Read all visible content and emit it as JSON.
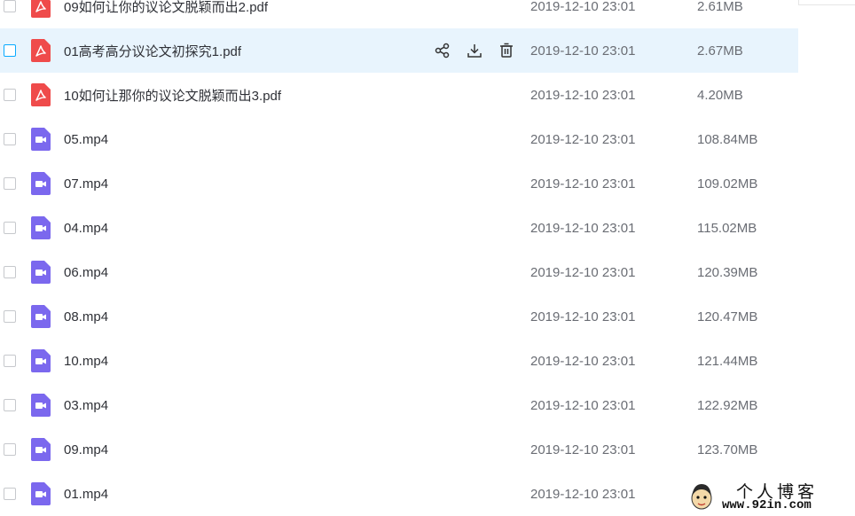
{
  "files": [
    {
      "name": "09如何让你的议论文脱颖而出2.pdf",
      "type": "pdf",
      "date": "2019-12-10 23:01",
      "size": "2.61MB",
      "highlighted": false
    },
    {
      "name": "01高考高分议论文初探究1.pdf",
      "type": "pdf",
      "date": "2019-12-10 23:01",
      "size": "2.67MB",
      "highlighted": true
    },
    {
      "name": "10如何让那你的议论文脱颖而出3.pdf",
      "type": "pdf",
      "date": "2019-12-10 23:01",
      "size": "4.20MB",
      "highlighted": false
    },
    {
      "name": "05.mp4",
      "type": "video",
      "date": "2019-12-10 23:01",
      "size": "108.84MB",
      "highlighted": false
    },
    {
      "name": "07.mp4",
      "type": "video",
      "date": "2019-12-10 23:01",
      "size": "109.02MB",
      "highlighted": false
    },
    {
      "name": "04.mp4",
      "type": "video",
      "date": "2019-12-10 23:01",
      "size": "115.02MB",
      "highlighted": false
    },
    {
      "name": "06.mp4",
      "type": "video",
      "date": "2019-12-10 23:01",
      "size": "120.39MB",
      "highlighted": false
    },
    {
      "name": "08.mp4",
      "type": "video",
      "date": "2019-12-10 23:01",
      "size": "120.47MB",
      "highlighted": false
    },
    {
      "name": "10.mp4",
      "type": "video",
      "date": "2019-12-10 23:01",
      "size": "121.44MB",
      "highlighted": false
    },
    {
      "name": "03.mp4",
      "type": "video",
      "date": "2019-12-10 23:01",
      "size": "122.92MB",
      "highlighted": false
    },
    {
      "name": "09.mp4",
      "type": "video",
      "date": "2019-12-10 23:01",
      "size": "123.70MB",
      "highlighted": false
    },
    {
      "name": "01.mp4",
      "type": "video",
      "date": "2019-12-10 23:01",
      "size": "",
      "highlighted": false
    }
  ],
  "row_actions": [
    "share-icon",
    "download-icon",
    "delete-icon"
  ],
  "colors": {
    "highlight": "#e8f4fd",
    "pdf_icon": "#ef4b4b",
    "video_icon": "#7b68ee",
    "accent": "#09aaff"
  },
  "watermark": {
    "title": "个人博客",
    "url": "www.92in.com"
  }
}
